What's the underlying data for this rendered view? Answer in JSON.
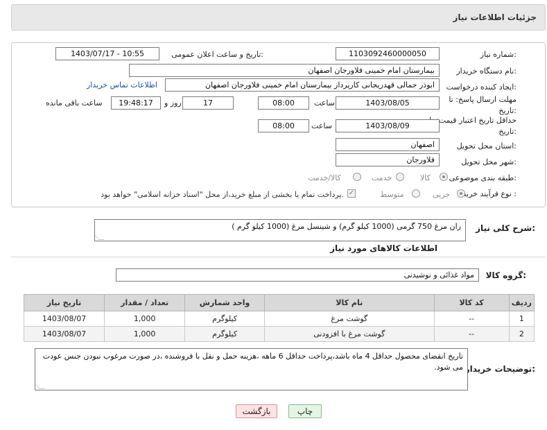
{
  "header": {
    "title": "جزئیات اطلاعات نیاز"
  },
  "form": {
    "need_number_label": "شماره نیاز:",
    "need_number": "1103092460000050",
    "announce_label": "تاریخ و ساعت اعلان عمومی:",
    "announce_value": "1403/07/17 - 10:55",
    "buyer_org_label": "نام دستگاه خریدار:",
    "buyer_org": "بیمارستان امام خمینی فلاورجان اصفهان",
    "requester_label": "ایجاد کننده درخواست:",
    "requester": "ابوذر جمالی قهدریجانی کارپرداز بیمارستان امام خمینی فلاورجان اصفهان",
    "contact_link": "اطلاعات تماس خریدار",
    "deadline_label": "مهلت ارسال پاسخ: تا تاریخ:",
    "deadline_date": "1403/08/05",
    "time_label": "ساعت",
    "deadline_time": "08:00",
    "days_value": "17",
    "days_label": "روز و",
    "remaining_time": "19:48:17",
    "remaining_label": "ساعت باقی مانده",
    "validity_label": "حداقل تاریخ اعتبار قیمت: تا تاریخ:",
    "validity_date": "1403/08/09",
    "validity_time": "08:00",
    "province_label": "استان محل تحویل:",
    "province": "اصفهان",
    "city_label": "شهر محل تحویل:",
    "city": "فلاورجان",
    "category_label": "طبقه بندی موضوعی:",
    "category_options": [
      "کالا",
      "خدمت",
      "کالا/خدمت"
    ],
    "process_label": "نوع فرآیند خرید :",
    "process_options": [
      "جزیی",
      "متوسط"
    ],
    "payment_note": "پرداخت تمام یا بخشی از مبلغ خرید،از محل \"اسناد خزانه اسلامی\" خواهد بود."
  },
  "description": {
    "label": "شرح کلی نیاز:",
    "text": "ران مرغ 750 گرمی (1000 کیلو گرم) و شینسل مرغ (1000 کیلو گرم )"
  },
  "goods": {
    "section_title": "اطلاعات کالاهای مورد نیاز",
    "group_label": "گروه کالا:",
    "group_value": "مواد غذائی و نوشیدنی",
    "columns": [
      "ردیف",
      "کد کالا",
      "نام کالا",
      "واحد شمارش",
      "تعداد / مقدار",
      "تاریخ نیاز"
    ],
    "rows": [
      {
        "row": "1",
        "code": "--",
        "name": "گوشت مرغ",
        "unit": "کیلوگرم",
        "qty": "1,000",
        "date": "1403/08/07"
      },
      {
        "row": "2",
        "code": "--",
        "name": "گوشت مرغ با افزودنی",
        "unit": "کیلوگرم",
        "qty": "1,000",
        "date": "1403/08/07"
      }
    ]
  },
  "buyer_notes": {
    "label": "توضیحات خریدار:",
    "text": "تاریخ انقضای محصول حداقل 4 ماه باشد،پرداخت حداقل 6 ماهه ،هزینه حمل و نقل با فروشنده ،در صورت مرغوب نبودن جنس عودت می شود."
  },
  "buttons": {
    "print": "چاپ",
    "back": "بازگشت"
  }
}
